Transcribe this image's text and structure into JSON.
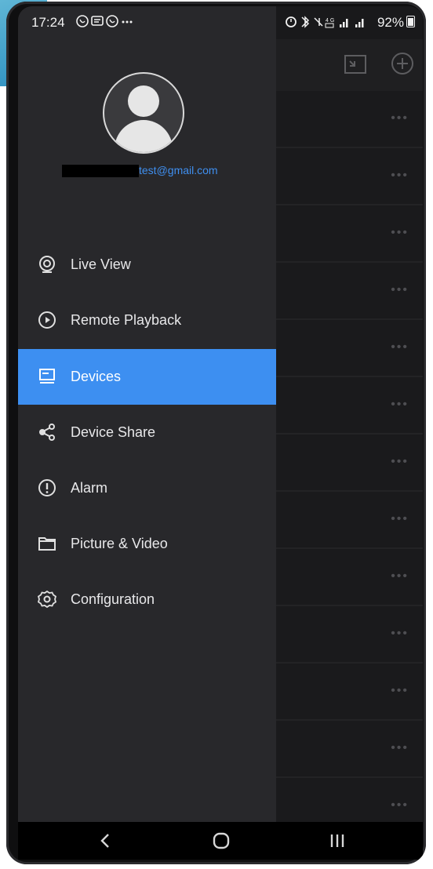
{
  "status_bar": {
    "time": "17:24",
    "left_icons": "© ✉ © ···",
    "right_icons": "⏰ ✱ ∕ 4G ▐ ▐",
    "battery": "92%"
  },
  "drawer": {
    "email": "test@gmail.com",
    "menu": [
      {
        "label": "Live View",
        "icon": "camera-icon"
      },
      {
        "label": "Remote Playback",
        "icon": "play-circle-icon"
      },
      {
        "label": "Devices",
        "icon": "devices-icon"
      },
      {
        "label": "Device Share",
        "icon": "share-icon"
      },
      {
        "label": "Alarm",
        "icon": "alarm-icon"
      },
      {
        "label": "Picture & Video",
        "icon": "folder-icon"
      },
      {
        "label": "Configuration",
        "icon": "gear-icon"
      }
    ],
    "active_item": "Devices"
  },
  "background_list": {
    "more_label": "•••"
  },
  "colors": {
    "accent": "#3d8ff1",
    "drawer_bg": "#28282b",
    "email": "#3f8ff0"
  }
}
